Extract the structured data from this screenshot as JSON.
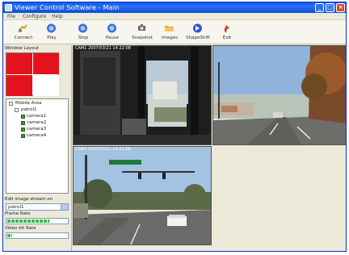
{
  "window": {
    "title": "Viewer Control Software - Main",
    "min_glyph": "_",
    "max_glyph": "□",
    "close_glyph": "×"
  },
  "menu": [
    "File",
    "Configure",
    "Help"
  ],
  "toolbar": [
    {
      "label": "Connect",
      "icon": "connect-icon",
      "color": "#d9a43a"
    },
    {
      "label": "Play",
      "icon": "play-icon",
      "color": "#3a6fd9"
    },
    {
      "label": "Stop",
      "icon": "stop-icon",
      "color": "#3a6fd9"
    },
    {
      "label": "Pause",
      "icon": "pause-icon",
      "color": "#3a6fd9"
    },
    {
      "label": "Snapshot",
      "icon": "snapshot-icon",
      "color": "#555555"
    },
    {
      "label": "Images",
      "icon": "folder-icon",
      "color": "#e8a42a"
    },
    {
      "label": "ShapeShift",
      "icon": "shapeshift-icon",
      "color": "#3a4fd9"
    },
    {
      "label": "Exit",
      "icon": "exit-icon",
      "color": "#d93a2a"
    }
  ],
  "left_panel": {
    "layout_label": "Window Layout",
    "layout_cells": [
      "red",
      "red",
      "red",
      "white"
    ],
    "tree": {
      "root": "Mobile Area",
      "group": "patrol1",
      "cameras": [
        "camera1",
        "camera2",
        "camera3",
        "camera4"
      ]
    },
    "select_label": "Edit image stream on",
    "select_value": "patrol1",
    "frame_rate_label": "Frame Rate",
    "frame_rate_value": 0.7,
    "bitrate_label": "Video bit Rate",
    "bitrate_value": 0.08
  },
  "video_feeds": [
    {
      "caption": "CAM1  2007/03/21  14:22:08"
    },
    {
      "caption": ""
    },
    {
      "caption": "CAM3  2007/03/21  14:22:08"
    }
  ],
  "colors": {
    "titlebar": "#0a5fe8",
    "layout_active": "#e4121d",
    "progress": "#37c23f"
  }
}
